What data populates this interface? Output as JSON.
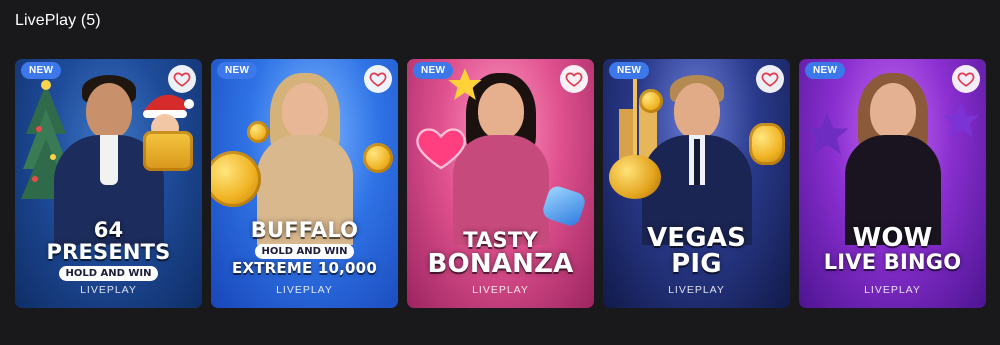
{
  "section": {
    "title": "LivePlay (5)"
  },
  "favorite_icon": "heart-icon",
  "colors": {
    "background": "#19191b",
    "badge": "#3d78ea",
    "heart_stroke": "#e03a4a"
  },
  "cards": [
    {
      "badge": "NEW",
      "lines": [
        "64",
        "PRESENTS"
      ],
      "pill": "HOLD AND WIN",
      "tail": "",
      "provider": "LIVEPLAY"
    },
    {
      "badge": "NEW",
      "lines": [
        "BUFFALO"
      ],
      "pill": "HOLD AND WIN",
      "tail": "EXTREME 10,000",
      "provider": "LIVEPLAY"
    },
    {
      "badge": "NEW",
      "lines": [
        "TASTY",
        "BONANZA"
      ],
      "pill": "",
      "tail": "",
      "provider": "LIVEPLAY"
    },
    {
      "badge": "NEW",
      "lines": [
        "VEGAS",
        "PIG"
      ],
      "pill": "",
      "tail": "",
      "provider": "LIVEPLAY"
    },
    {
      "badge": "NEW",
      "lines": [
        "WOW",
        "LIVE BINGO"
      ],
      "pill": "",
      "tail": "",
      "provider": "LIVEPLAY"
    }
  ]
}
